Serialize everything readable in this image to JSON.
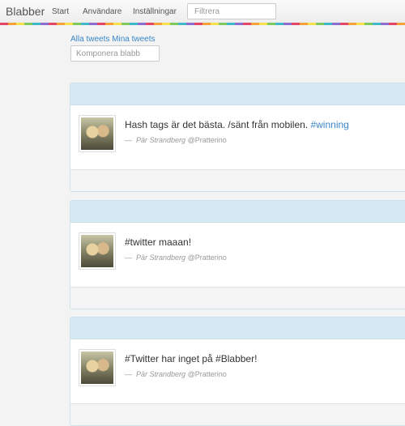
{
  "nav": {
    "brand": "Blabber",
    "links": [
      "Start",
      "Användare",
      "Inställningar"
    ],
    "filter_placeholder": "Filtrera"
  },
  "timeline": {
    "tab_all": "Alla tweets",
    "tab_mine": "Mina tweets",
    "compose_placeholder": "Komponera blabb"
  },
  "tweets": [
    {
      "text": "Hash tags är det bästa. /sänt från mobilen. ",
      "hashtag": "#winning",
      "dash": "—",
      "author": "Pär Strandberg",
      "handle": "@Pratterino"
    },
    {
      "text": "",
      "hashtag": "#twitter maaan!",
      "dash": "—",
      "author": "Pär Strandberg",
      "handle": "@Pratterino"
    },
    {
      "text": "",
      "hashtag": "#Twitter har inget på #Blabber!",
      "dash": "—",
      "author": "Pär Strandberg",
      "handle": "@Pratterino"
    }
  ],
  "colors": {
    "link": "#3a86c8",
    "card_header": "#d5eaf4",
    "card_footer": "#f5f5f5"
  }
}
